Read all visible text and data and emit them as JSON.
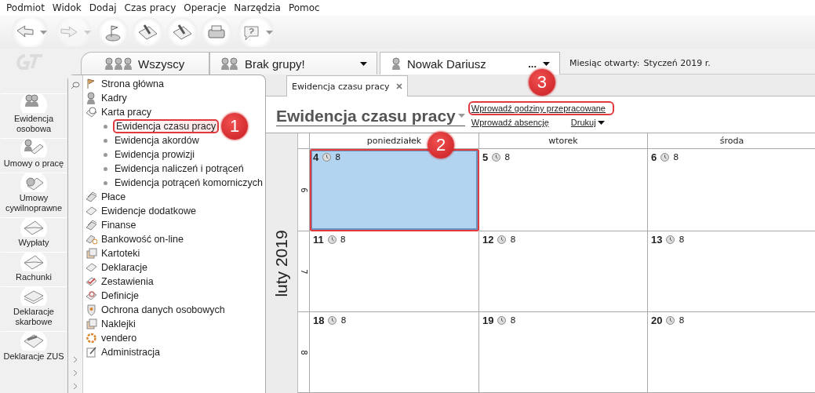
{
  "menu": [
    "Podmiot",
    "Widok",
    "Dodaj",
    "Czas pracy",
    "Operacje",
    "Narzędzia",
    "Pomoc"
  ],
  "toolbar": [
    {
      "dropdown": true,
      "disabled": false
    },
    {
      "dropdown": true,
      "disabled": true
    },
    {
      "dropdown": false,
      "disabled": false
    },
    {
      "dropdown": false,
      "disabled": false
    },
    {
      "dropdown": false,
      "disabled": false
    },
    {
      "dropdown": false,
      "disabled": false
    },
    {
      "dropdown": true,
      "disabled": false
    }
  ],
  "selectors": [
    {
      "kind": "all",
      "label": "Wszyscy"
    },
    {
      "kind": "group",
      "label": "Brak grupy!",
      "dropdown": true
    },
    {
      "kind": "person",
      "label": "Nowak Dariusz",
      "more": "...",
      "dropdown": true
    }
  ],
  "open_month": {
    "label": "Miesiąc otwarty:",
    "value": "Styczeń 2019 r."
  },
  "modules": [
    "Ewidencja osobowa",
    "Umowy o pracę",
    "Umowy cywilnoprawne",
    "Wypłaty",
    "Rachunki",
    "Deklaracje skarbowe",
    "Deklaracje ZUS"
  ],
  "tree": [
    {
      "label": "Strona główna",
      "selected": false
    },
    {
      "label": "Kadry",
      "selected": false
    },
    {
      "label": "Karta pracy",
      "selected": false,
      "children": [
        {
          "label": "Ewidencja czasu pracy",
          "selected": true,
          "callout": "1"
        },
        {
          "label": "Ewidencja akordów",
          "selected": false
        },
        {
          "label": "Ewidencja prowizji",
          "selected": false
        },
        {
          "label": "Ewidencja naliczeń i potrąceń",
          "selected": false
        },
        {
          "label": "Ewidencja potrąceń komorniczych",
          "selected": false
        }
      ]
    },
    {
      "label": "Płace",
      "selected": false
    },
    {
      "label": "Ewidencje dodatkowe",
      "selected": false
    },
    {
      "label": "Finanse",
      "selected": false
    },
    {
      "label": "Bankowość on-line",
      "selected": false
    },
    {
      "label": "Kartoteki",
      "selected": false
    },
    {
      "label": "Deklaracje",
      "selected": false
    },
    {
      "label": "Zestawienia",
      "selected": false
    },
    {
      "label": "Definicje",
      "selected": false
    },
    {
      "label": "Ochrona danych osobowych",
      "selected": false
    },
    {
      "label": "Naklejki",
      "selected": false
    },
    {
      "label": "vendero",
      "selected": false
    },
    {
      "label": "Administracja",
      "selected": false
    }
  ],
  "doc_tab": {
    "label": "Ewidencja czasu pracy",
    "selected": true
  },
  "page": {
    "title": "Ewidencja czasu pracy",
    "actions": [
      {
        "label": "Wprowadź godziny przepracowane",
        "highlighted": true,
        "callout": "3"
      },
      {
        "label": "Wprowadź absencję",
        "highlighted": false
      },
      {
        "label": "Drukuj",
        "highlighted": false,
        "dropdown": true
      }
    ]
  },
  "calendar": {
    "month": "luty 2019",
    "days": [
      "poniedziałek",
      "wtorek",
      "środa"
    ],
    "weeks": [
      {
        "number": "6",
        "cells": [
          {
            "day": "4",
            "hours": "8",
            "selected": true,
            "callout": "2"
          },
          {
            "day": "5",
            "hours": "8",
            "selected": false
          },
          {
            "day": "6",
            "hours": "8",
            "selected": false
          }
        ]
      },
      {
        "number": "7",
        "cells": [
          {
            "day": "11",
            "hours": "8",
            "selected": false
          },
          {
            "day": "12",
            "hours": "8",
            "selected": false
          },
          {
            "day": "13",
            "hours": "8",
            "selected": false
          }
        ]
      },
      {
        "number": "8",
        "cells": [
          {
            "day": "18",
            "hours": "8",
            "selected": false
          },
          {
            "day": "19",
            "hours": "8",
            "selected": false
          },
          {
            "day": "20",
            "hours": "8",
            "selected": false
          }
        ]
      }
    ]
  }
}
